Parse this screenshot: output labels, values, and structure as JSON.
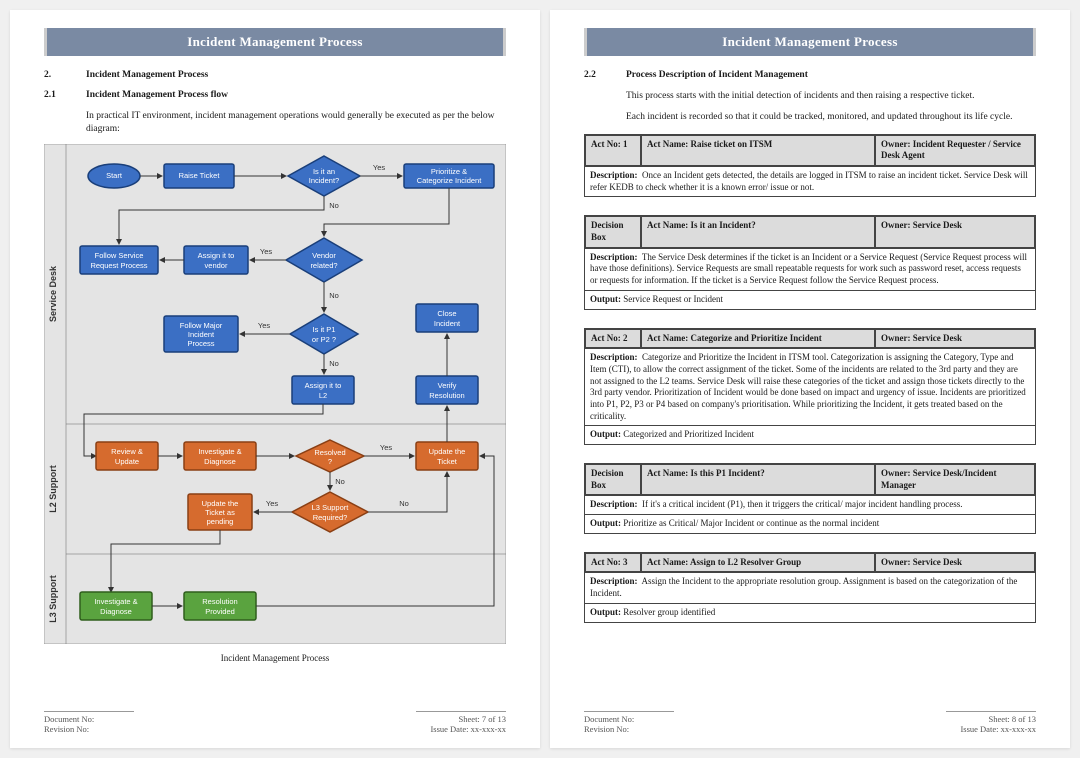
{
  "header": "Incident Management Process",
  "p1": {
    "s1": {
      "num": "2.",
      "title": "Incident Management Process"
    },
    "s2": {
      "num": "2.1",
      "title": "Incident Management Process flow"
    },
    "intro": "In practical IT environment, incident management operations would generally be executed as per the below diagram:",
    "figcap": "Incident Management Process",
    "lanes": {
      "a": "Service Desk",
      "b": "L2 Support",
      "c": "L3 Support"
    },
    "nodes": {
      "start": "Start",
      "raise": "Raise Ticket",
      "isinc": "Is it an",
      "isinc2": "Incident?",
      "prio": "Prioritize &",
      "prio2": "Categorize Incident",
      "fsrp": "Follow Service",
      "fsrp2": "Request Process",
      "assignv": "Assign it to",
      "assignv2": "vendor",
      "vendor": "Vendor",
      "vendor2": "related?",
      "fmip": "Follow Major",
      "fmip2": "Incident",
      "fmip3": "Process",
      "p1p2": "Is it P1",
      "p1p22": "or P2 ?",
      "close": "Close",
      "close2": "Incident",
      "assignl2": "Assign it to",
      "assignl22": "L2",
      "verify": "Verify",
      "verify2": "Resolution",
      "review": "Review &",
      "review2": "Update",
      "invdiag": "Investigate &",
      "invdiag2": "Diagnose",
      "resolved": "Resolved",
      "resolved2": "?",
      "updtkt": "Update the",
      "updtkt2": "Ticket",
      "updpend": "Update the",
      "updpend2": "Ticket as",
      "updpend3": "pending",
      "l3req": "L3 Support",
      "l3req2": "Required?",
      "invdiag3": "Investigate &",
      "invdiag32": "Diagnose",
      "resprov": "Resolution",
      "resprov2": "Provided"
    },
    "yn": {
      "yes": "Yes",
      "no": "No"
    }
  },
  "p2": {
    "s1": {
      "num": "2.2",
      "title": "Process Description of Incident Management"
    },
    "para1": "This process starts with the initial detection of incidents and then raising a respective ticket.",
    "para2": "Each incident is recorded so that it could be tracked, monitored, and updated throughout its life cycle.",
    "t1": {
      "actno": "Act No:",
      "actnoV": "1",
      "actname": "Act Name:",
      "actnameV": "Raise ticket on ITSM",
      "owner": "Owner:",
      "ownerV": "Incident Requester / Service Desk Agent",
      "descL": "Description:",
      "desc": "Once an Incident gets detected, the details are logged in ITSM to raise an incident ticket.  Service Desk will refer KEDB to check whether it is a known error/ issue or not."
    },
    "t2": {
      "actno": "Decision Box",
      "actname": "Act Name:",
      "actnameV": "Is it an Incident?",
      "owner": "Owner:",
      "ownerV": "Service Desk",
      "descL": "Description:",
      "desc": "The Service Desk determines if the ticket is an Incident or a Service Request (Service Request process will have those definitions). Service Requests are small repeatable requests for work such as password reset, access requests or requests for information. If the ticket is a Service Request follow the Service Request process.",
      "outL": "Output:",
      "out": "Service Request or Incident"
    },
    "t3": {
      "actno": "Act No:",
      "actnoV": "2",
      "actname": "Act Name:",
      "actnameV": "Categorize and Prioritize Incident",
      "owner": "Owner:",
      "ownerV": "Service Desk",
      "descL": "Description:",
      "desc": "Categorize and Prioritize the Incident in ITSM tool. Categorization is assigning the Category, Type and Item (CTI), to allow the correct assignment of the ticket. Some of the incidents are related to the 3rd party and they are not assigned to the L2 teams. Service Desk will raise these categories of the ticket and assign those tickets directly to the 3rd party vendor. Prioritization of Incident would be done based on impact and urgency of issue. Incidents are prioritized into P1, P2, P3 or P4 based on company's prioritisation. While prioritizing the Incident, it gets treated based on the criticality.",
      "outL": "Output:",
      "out": "Categorized and Prioritized Incident"
    },
    "t4": {
      "actno": "Decision Box",
      "actname": "Act Name:",
      "actnameV": "Is this P1 Incident?",
      "owner": "Owner:",
      "ownerV": "Service Desk/Incident Manager",
      "descL": "Description:",
      "desc": "If it's a critical incident (P1), then it triggers the critical/ major incident handling process.",
      "outL": "Output:",
      "out": "Prioritize as Critical/ Major Incident or continue as the normal incident"
    },
    "t5": {
      "actno": "Act No:",
      "actnoV": "3",
      "actname": "Act Name:",
      "actnameV": "Assign to L2 Resolver Group",
      "owner": "Owner:",
      "ownerV": "Service Desk",
      "descL": "Description:",
      "desc": "Assign the Incident to the appropriate resolution group. Assignment is based on the categorization of the Incident.",
      "outL": "Output:",
      "out": "Resolver group identified"
    }
  },
  "foot": {
    "doc": "Document No:",
    "rev": "Revision No:",
    "sheet7": "Sheet: 7 of 13",
    "sheet8": "Sheet: 8 of 13",
    "issue": "Issue Date: xx-xxx-xx"
  }
}
